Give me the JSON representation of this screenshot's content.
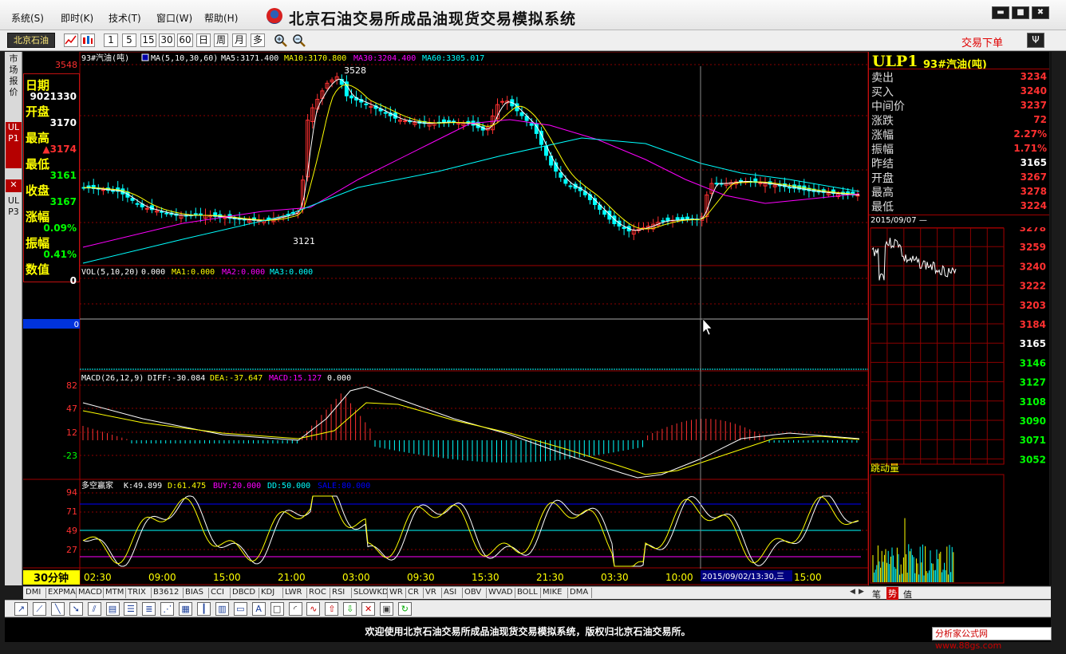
{
  "menu": {
    "items": [
      "系统(S)",
      "即时(K)",
      "技术(T)",
      "窗口(W)",
      "帮助(H)"
    ],
    "app_title": "北京石油交易所成品油现货交易模拟系统"
  },
  "window_controls": {
    "minimize": "▬",
    "maximize": "■",
    "close": "✖"
  },
  "toolbar": {
    "exchange_label": "北京石油",
    "period_buttons": [
      "1",
      "5",
      "15",
      "30",
      "60",
      "日",
      "周",
      "月",
      "多"
    ],
    "trade_order_label": "交易下单",
    "pin_label": "Ψ"
  },
  "left_tabs": {
    "quote": "市场报价",
    "ulp1": "ULP1",
    "close": "✕",
    "ulp3": "ULP3"
  },
  "info_panel": {
    "rows": [
      {
        "label": "日期",
        "value": "9021330",
        "color": "#ffffff"
      },
      {
        "label": "开盘",
        "value": "3170",
        "color": "#ffffff"
      },
      {
        "label": "最高",
        "value": "▲3174",
        "color": "#ff3030"
      },
      {
        "label": "最低",
        "value": "3161",
        "color": "#00ff00"
      },
      {
        "label": "收盘",
        "value": "3167",
        "color": "#00ff00"
      },
      {
        "label": "涨幅",
        "value": "0.09%",
        "color": "#00ff00"
      },
      {
        "label": "振幅",
        "value": "0.41%",
        "color": "#00ff00"
      },
      {
        "label": "数值",
        "value": "0",
        "color": "#ffffff"
      }
    ]
  },
  "price_chart": {
    "legend_name": "93#汽油(吨)",
    "ma_label": "MA(5,10,30,60)",
    "ma5": "MA5:3171.400",
    "ma10": "MA10:3170.800",
    "ma30": "MA30:3204.400",
    "ma60": "MA60:3305.017",
    "top_price": "3548",
    "high_marker": "3528",
    "low_marker": "3121"
  },
  "volume_chart": {
    "label": "VOL(5,10,20)",
    "value": "0.000",
    "ma1": "MA1:0.000",
    "ma2": "MA2:0.000",
    "ma3": "MA3:0.000",
    "axis_value": "0"
  },
  "macd_chart": {
    "label": "MACD(26,12,9)",
    "diff": "DIFF:-30.084",
    "dea": "DEA:-37.647",
    "macd": "MACD:15.127",
    "extra": "0.000",
    "ticks": [
      "82",
      "47",
      "12",
      "-23"
    ]
  },
  "kd_chart": {
    "label": "多空赢家",
    "k": "K:49.899",
    "d": "D:61.475",
    "buy": "BUY:20.000",
    "dd": "DD:50.000",
    "sale": "SALE:80.000",
    "ticks": [
      "94",
      "71",
      "49",
      "27"
    ]
  },
  "time_axis": {
    "period_label": "30分钟",
    "labels": [
      "02:30",
      "09:00",
      "15:00",
      "21:00",
      "03:00",
      "09:30",
      "15:30",
      "21:30",
      "03:30",
      "10:00",
      "15:00"
    ],
    "cursor_time": "2015/09/02/13:30,三"
  },
  "quote_panel": {
    "code": "ULP1",
    "name": "93#汽油(吨)",
    "rows": [
      {
        "label": "卖出",
        "value": "3234",
        "color": "#ff3030"
      },
      {
        "label": "买入",
        "value": "3240",
        "color": "#ff3030"
      },
      {
        "label": "中间价",
        "value": "3237",
        "color": "#ff3030"
      },
      {
        "label": "涨跌",
        "value": "72",
        "color": "#ff3030"
      },
      {
        "label": "涨幅",
        "value": "2.27%",
        "color": "#ff3030"
      },
      {
        "label": "振幅",
        "value": "1.71%",
        "color": "#ff3030"
      },
      {
        "label": "昨结",
        "value": "3165",
        "color": "#ffffff"
      },
      {
        "label": "开盘",
        "value": "3267",
        "color": "#ff3030"
      },
      {
        "label": "最高",
        "value": "3278",
        "color": "#ff3030"
      },
      {
        "label": "最低",
        "value": "3224",
        "color": "#ff3030"
      }
    ]
  },
  "mini_chart": {
    "date_label": "2015/09/07  —",
    "price_ticks": [
      "3278",
      "3259",
      "3240",
      "3222",
      "3203",
      "3184",
      "3165",
      "3146",
      "3127",
      "3108",
      "3090",
      "3071",
      "3052"
    ],
    "tick_label": "跳动量"
  },
  "indicator_tabs": [
    "DMI",
    "EXPMA",
    "MACD",
    "MTM",
    "TRIX",
    "B3612",
    "BIAS",
    "CCI",
    "DBCD",
    "KDJ",
    "LWR",
    "ROC",
    "RSI",
    "SLOWKD",
    "WR",
    "CR",
    "VR",
    "ASI",
    "OBV",
    "WVAD",
    "BOLL",
    "MIKE",
    "DMA"
  ],
  "side_tabs": [
    "笔",
    "势",
    "值"
  ],
  "status": {
    "message": "欢迎使用北京石油交易所成品油现货交易模拟系统，版权归北京石油交易所。",
    "watermark": "分析家公式网www.88gs.com"
  },
  "colors": {
    "up": "#ff3030",
    "down": "#00ffff",
    "ma5": "#ffffff",
    "ma10": "#ffff00",
    "ma30": "#ff00ff",
    "ma60": "#00ffff",
    "grid": "#8b0000",
    "kd_k": "#ffffff",
    "kd_d": "#ffff00"
  }
}
